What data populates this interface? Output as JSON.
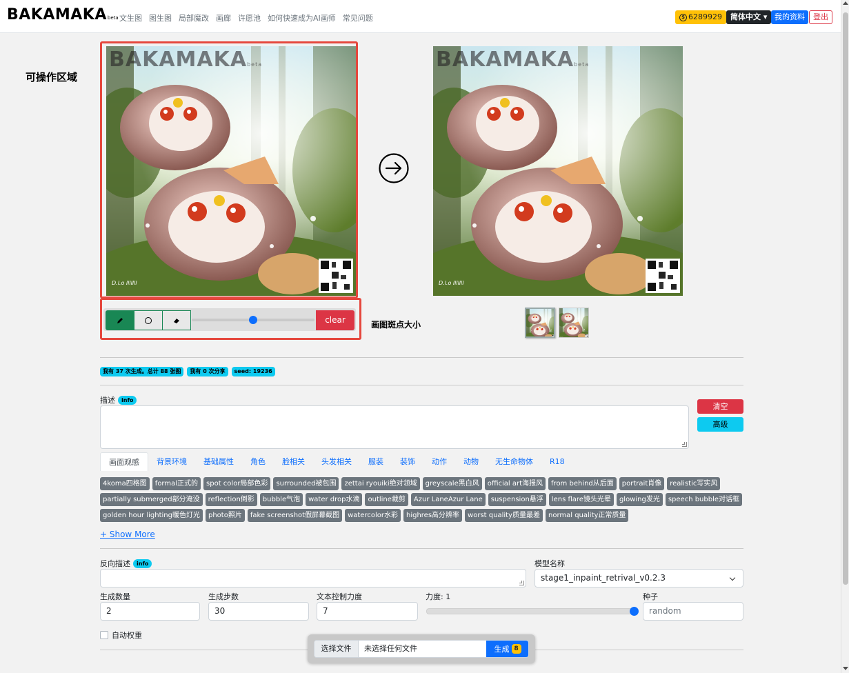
{
  "nav": {
    "brand": "BAKAMAKA",
    "brand_suffix": "beta",
    "links": [
      "文生图",
      "图生图",
      "局部魔改",
      "画廊",
      "许愿池",
      "如何快速成为AI画师",
      "常见问题"
    ],
    "coins": "6289929",
    "coin_icon": "coin-icon",
    "language": "简体中文",
    "profile": "我的资料",
    "logout": "登出"
  },
  "annotations": {
    "editable_area": "可操作区域",
    "brush_size": "画图斑点大小"
  },
  "canvas": {
    "watermark": "BAKAMAKA",
    "watermark_suffix": "beta",
    "clear": "clear",
    "brush_size_level": 0.5,
    "tools": [
      "pencil-icon",
      "circle-icon",
      "eraser-icon"
    ]
  },
  "stats": [
    "我有 37 次生成。总计 88 张图",
    "我有 0 次分享",
    "seed: 19236"
  ],
  "prompt": {
    "label": "描述",
    "info": "info",
    "clear": "清空",
    "advanced": "高级",
    "value": ""
  },
  "tabs": [
    "画面观感",
    "背景环境",
    "基础属性",
    "角色",
    "脸相关",
    "头发相关",
    "服装",
    "装饰",
    "动作",
    "动物",
    "无生命物体",
    "R18"
  ],
  "tags": [
    "4koma四格图",
    "formal正式的",
    "spot color局部色彩",
    "surrounded被包围",
    "zettai ryouiki绝对领域",
    "greyscale黑白风",
    "official art海报风",
    "from behind从后面",
    "portrait肖像",
    "realistic写实风",
    "partially submerged部分淹没",
    "reflection倒影",
    "bubble气泡",
    "water drop水滴",
    "outline裁剪",
    "Azur LaneAzur Lane",
    "suspension悬浮",
    "lens flare镜头光晕",
    "glowing发光",
    "speech bubble对话框",
    "golden hour lighting暖色灯光",
    "photo照片",
    "fake screenshot假屏幕截图",
    "watercolor水彩",
    "highres高分辨率",
    "worst quality质量最差",
    "normal quality正常质量"
  ],
  "show_more": "+ Show More",
  "negative": {
    "label": "反向描述",
    "info": "info",
    "value": ""
  },
  "model": {
    "label": "模型名称",
    "value": "stage1_inpaint_retrival_v0.2.3"
  },
  "params": {
    "count_label": "生成数量",
    "count": "2",
    "steps_label": "生成步数",
    "steps": "30",
    "guidance_label": "文本控制力度",
    "guidance": "7",
    "strength_label": "力度: 1",
    "strength_level": 1,
    "seed_label": "种子",
    "seed_placeholder": "random"
  },
  "auto_weight": "自动权重",
  "file": {
    "choose": "选择文件",
    "none": "未选择任何文件",
    "generate": "生成",
    "generate_count": "8"
  }
}
